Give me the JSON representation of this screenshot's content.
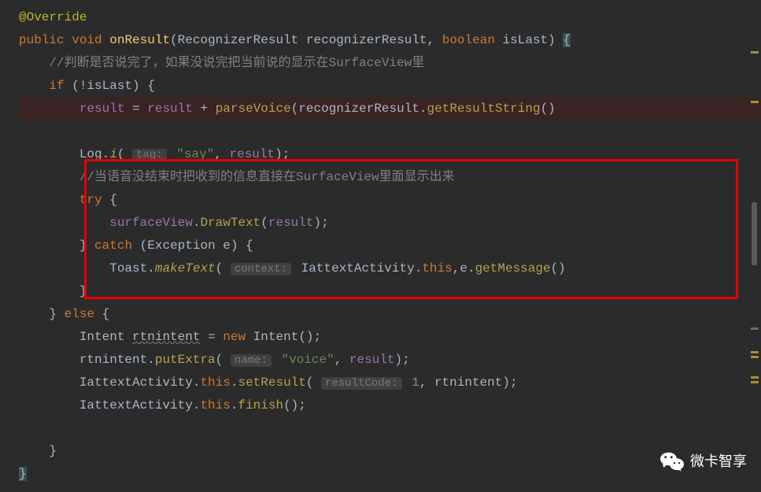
{
  "code": {
    "annotation": "@Override",
    "modifier_public": "public",
    "modifier_void": "void",
    "method_name": "onResult",
    "param1_type": "RecognizerResult",
    "param1_name": "recognizerResult",
    "param2_type": "boolean",
    "param2_name": "isLast",
    "comment1": "//判断是否说完了，如果没说完把当前说的显示在SurfaceView里",
    "kw_if": "if",
    "cond_not": "!isLast",
    "field_result": "result",
    "assign_result2": "result",
    "method_parseVoice": "parseVoice",
    "call_recognizerResult": "recognizerResult",
    "call_getResultString": "getResultString",
    "log_class": "Log",
    "log_method": "i",
    "hint_tag": "tag:",
    "str_say": "\"say\"",
    "log_arg2": "result",
    "comment2": "//当语音没结束时把收到的信息直接在SurfaceView里面显示出来",
    "kw_try": "try",
    "field_surfaceView": "surfaceView",
    "method_DrawText": "DrawText",
    "drawtext_arg": "result",
    "kw_catch": "catch",
    "exc_type": "Exception",
    "exc_var": "e",
    "toast_class": "Toast",
    "toast_method": "makeText",
    "hint_context": "context:",
    "toast_activity": "IattextActivity",
    "kw_this": "this",
    "toast_e": "e",
    "toast_getMessage": "getMessage",
    "kw_else": "else",
    "intent_type": "Intent",
    "intent_var": "rtnintent",
    "kw_new": "new",
    "intent_ctor": "Intent",
    "putExtra_var": "rtnintent",
    "putExtra_method": "putExtra",
    "hint_name": "name:",
    "str_voice": "\"voice\"",
    "putExtra_arg2": "result",
    "setResult_class": "IattextActivity",
    "setResult_method": "setResult",
    "hint_resultCode": "resultCode:",
    "num_1": "1",
    "setResult_arg2": "rtnintent",
    "finish_class": "IattextActivity",
    "finish_method": "finish"
  },
  "watermark": {
    "text": "微卡智享"
  }
}
